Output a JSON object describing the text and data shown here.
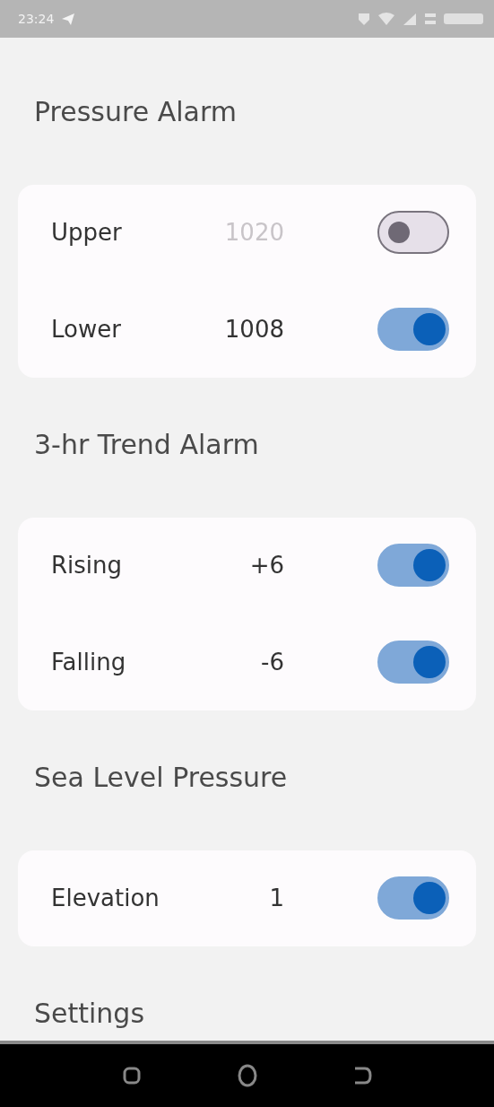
{
  "status_bar": {
    "time": "23:24"
  },
  "sections": [
    {
      "title": "Pressure Alarm",
      "rows": [
        {
          "label": "Upper",
          "value": "1020",
          "on": false
        },
        {
          "label": "Lower",
          "value": "1008",
          "on": true
        }
      ]
    },
    {
      "title": "3-hr Trend Alarm",
      "rows": [
        {
          "label": "Rising",
          "value": "+6",
          "on": true
        },
        {
          "label": "Falling",
          "value": "-6",
          "on": true
        }
      ]
    },
    {
      "title": "Sea Level Pressure",
      "rows": [
        {
          "label": "Elevation",
          "value": "1",
          "on": true
        }
      ]
    },
    {
      "title": "Settings"
    }
  ]
}
